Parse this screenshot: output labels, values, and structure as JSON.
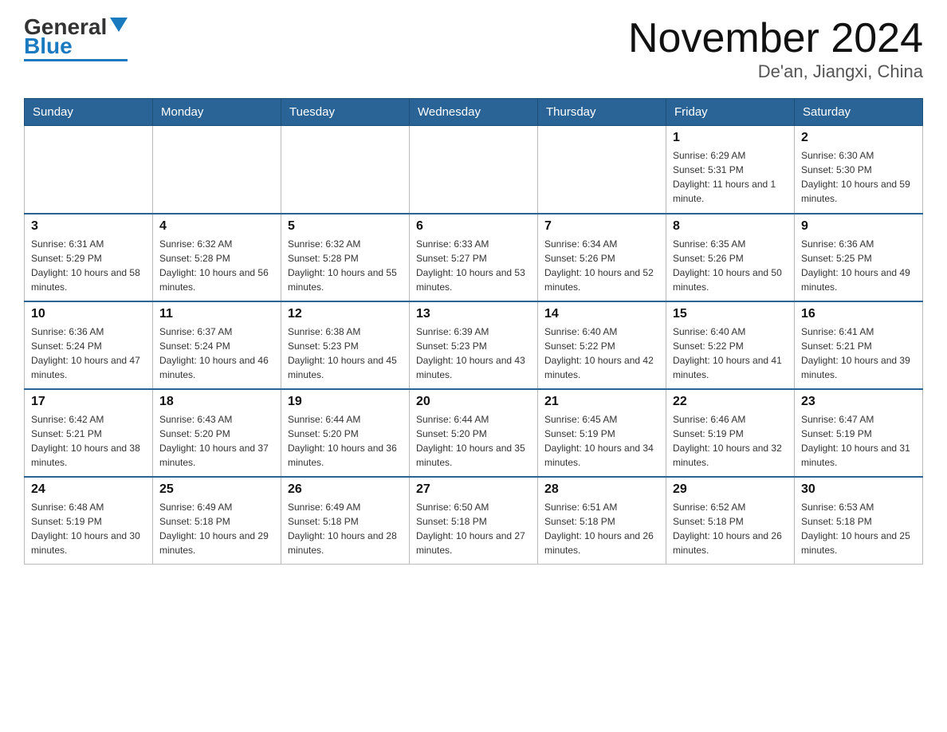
{
  "header": {
    "logo_general": "General",
    "logo_blue": "Blue",
    "month_title": "November 2024",
    "subtitle": "De'an, Jiangxi, China"
  },
  "days_of_week": [
    "Sunday",
    "Monday",
    "Tuesday",
    "Wednesday",
    "Thursday",
    "Friday",
    "Saturday"
  ],
  "weeks": [
    [
      {
        "day": "",
        "info": ""
      },
      {
        "day": "",
        "info": ""
      },
      {
        "day": "",
        "info": ""
      },
      {
        "day": "",
        "info": ""
      },
      {
        "day": "",
        "info": ""
      },
      {
        "day": "1",
        "info": "Sunrise: 6:29 AM\nSunset: 5:31 PM\nDaylight: 11 hours and 1 minute."
      },
      {
        "day": "2",
        "info": "Sunrise: 6:30 AM\nSunset: 5:30 PM\nDaylight: 10 hours and 59 minutes."
      }
    ],
    [
      {
        "day": "3",
        "info": "Sunrise: 6:31 AM\nSunset: 5:29 PM\nDaylight: 10 hours and 58 minutes."
      },
      {
        "day": "4",
        "info": "Sunrise: 6:32 AM\nSunset: 5:28 PM\nDaylight: 10 hours and 56 minutes."
      },
      {
        "day": "5",
        "info": "Sunrise: 6:32 AM\nSunset: 5:28 PM\nDaylight: 10 hours and 55 minutes."
      },
      {
        "day": "6",
        "info": "Sunrise: 6:33 AM\nSunset: 5:27 PM\nDaylight: 10 hours and 53 minutes."
      },
      {
        "day": "7",
        "info": "Sunrise: 6:34 AM\nSunset: 5:26 PM\nDaylight: 10 hours and 52 minutes."
      },
      {
        "day": "8",
        "info": "Sunrise: 6:35 AM\nSunset: 5:26 PM\nDaylight: 10 hours and 50 minutes."
      },
      {
        "day": "9",
        "info": "Sunrise: 6:36 AM\nSunset: 5:25 PM\nDaylight: 10 hours and 49 minutes."
      }
    ],
    [
      {
        "day": "10",
        "info": "Sunrise: 6:36 AM\nSunset: 5:24 PM\nDaylight: 10 hours and 47 minutes."
      },
      {
        "day": "11",
        "info": "Sunrise: 6:37 AM\nSunset: 5:24 PM\nDaylight: 10 hours and 46 minutes."
      },
      {
        "day": "12",
        "info": "Sunrise: 6:38 AM\nSunset: 5:23 PM\nDaylight: 10 hours and 45 minutes."
      },
      {
        "day": "13",
        "info": "Sunrise: 6:39 AM\nSunset: 5:23 PM\nDaylight: 10 hours and 43 minutes."
      },
      {
        "day": "14",
        "info": "Sunrise: 6:40 AM\nSunset: 5:22 PM\nDaylight: 10 hours and 42 minutes."
      },
      {
        "day": "15",
        "info": "Sunrise: 6:40 AM\nSunset: 5:22 PM\nDaylight: 10 hours and 41 minutes."
      },
      {
        "day": "16",
        "info": "Sunrise: 6:41 AM\nSunset: 5:21 PM\nDaylight: 10 hours and 39 minutes."
      }
    ],
    [
      {
        "day": "17",
        "info": "Sunrise: 6:42 AM\nSunset: 5:21 PM\nDaylight: 10 hours and 38 minutes."
      },
      {
        "day": "18",
        "info": "Sunrise: 6:43 AM\nSunset: 5:20 PM\nDaylight: 10 hours and 37 minutes."
      },
      {
        "day": "19",
        "info": "Sunrise: 6:44 AM\nSunset: 5:20 PM\nDaylight: 10 hours and 36 minutes."
      },
      {
        "day": "20",
        "info": "Sunrise: 6:44 AM\nSunset: 5:20 PM\nDaylight: 10 hours and 35 minutes."
      },
      {
        "day": "21",
        "info": "Sunrise: 6:45 AM\nSunset: 5:19 PM\nDaylight: 10 hours and 34 minutes."
      },
      {
        "day": "22",
        "info": "Sunrise: 6:46 AM\nSunset: 5:19 PM\nDaylight: 10 hours and 32 minutes."
      },
      {
        "day": "23",
        "info": "Sunrise: 6:47 AM\nSunset: 5:19 PM\nDaylight: 10 hours and 31 minutes."
      }
    ],
    [
      {
        "day": "24",
        "info": "Sunrise: 6:48 AM\nSunset: 5:19 PM\nDaylight: 10 hours and 30 minutes."
      },
      {
        "day": "25",
        "info": "Sunrise: 6:49 AM\nSunset: 5:18 PM\nDaylight: 10 hours and 29 minutes."
      },
      {
        "day": "26",
        "info": "Sunrise: 6:49 AM\nSunset: 5:18 PM\nDaylight: 10 hours and 28 minutes."
      },
      {
        "day": "27",
        "info": "Sunrise: 6:50 AM\nSunset: 5:18 PM\nDaylight: 10 hours and 27 minutes."
      },
      {
        "day": "28",
        "info": "Sunrise: 6:51 AM\nSunset: 5:18 PM\nDaylight: 10 hours and 26 minutes."
      },
      {
        "day": "29",
        "info": "Sunrise: 6:52 AM\nSunset: 5:18 PM\nDaylight: 10 hours and 26 minutes."
      },
      {
        "day": "30",
        "info": "Sunrise: 6:53 AM\nSunset: 5:18 PM\nDaylight: 10 hours and 25 minutes."
      }
    ]
  ]
}
